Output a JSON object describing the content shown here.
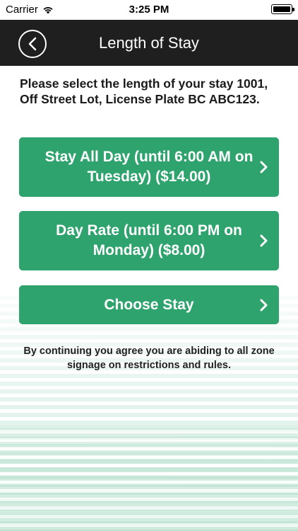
{
  "status_bar": {
    "carrier": "Carrier",
    "time": "3:25 PM"
  },
  "nav": {
    "title": "Length of Stay",
    "back_icon": "chevron-left-icon"
  },
  "intro_text": "Please select the length of your stay 1001, Off Street Lot,  License Plate BC ABC123.",
  "options": [
    {
      "label": "Stay All Day (until 6:00 AM on Tuesday) ($14.00)"
    },
    {
      "label": "Day Rate (until 6:00 PM on Monday) ($8.00)"
    },
    {
      "label": "Choose Stay"
    }
  ],
  "disclaimer": "By continuing you agree you are abiding to all zone signage on restrictions and rules.",
  "colors": {
    "button": "#2ea36e",
    "navbar": "#1f1f1f",
    "stripe": "#a8dac4"
  }
}
